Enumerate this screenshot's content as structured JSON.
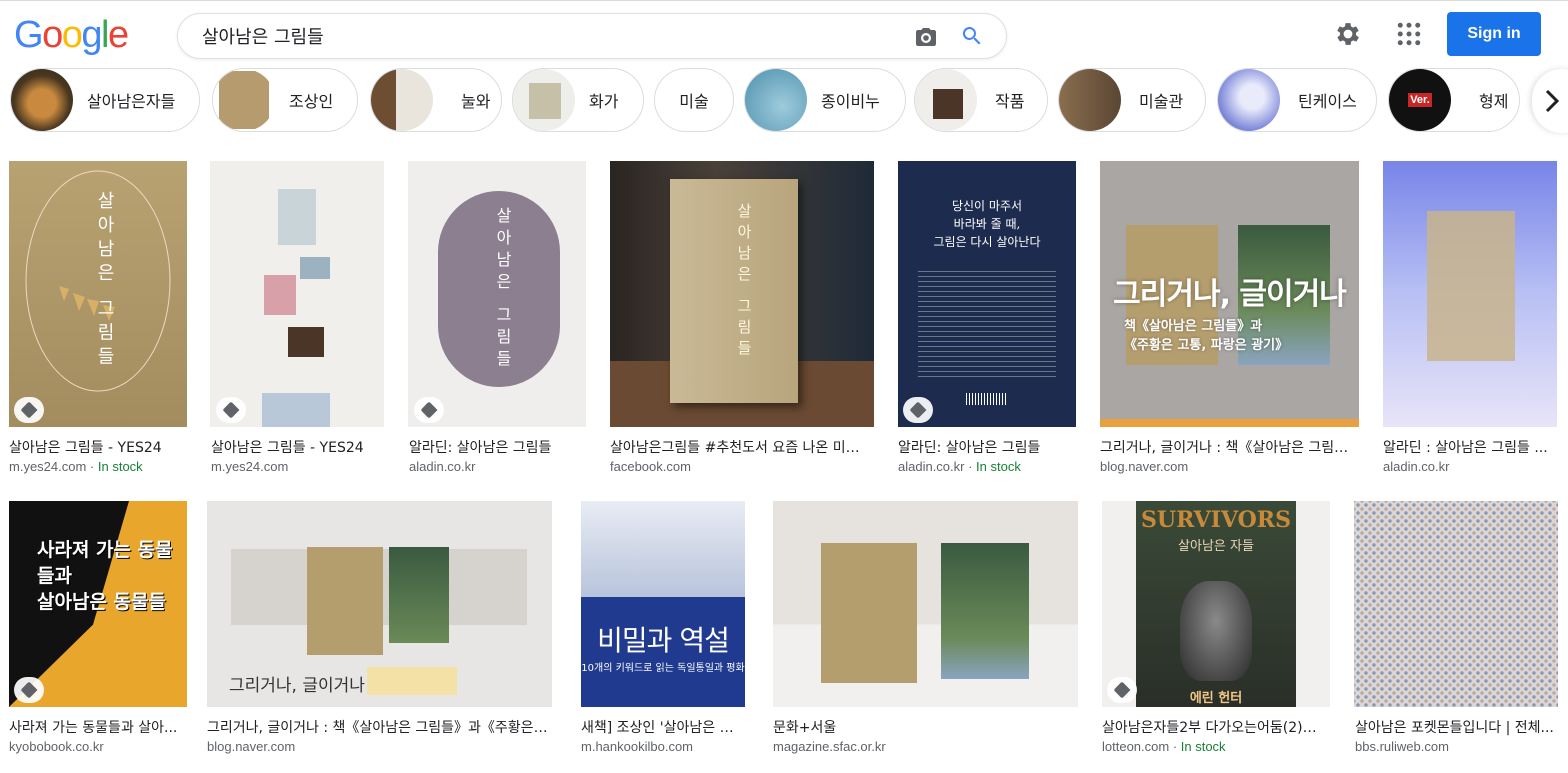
{
  "logo": "Google",
  "search": {
    "query": "살아남은 그림들"
  },
  "header": {
    "sign_in": "Sign in"
  },
  "chips": [
    {
      "label": "살아남은자들",
      "thumb": "#7a5a2e"
    },
    {
      "label": "조상인",
      "thumb": "#b69b6e"
    },
    {
      "label": "눌와",
      "thumb": "#8a6c4f"
    },
    {
      "label": "화가",
      "thumb": "#d8d3c6"
    },
    {
      "label": "미술",
      "thumb": ""
    },
    {
      "label": "종이비누",
      "thumb": "#6aa9c2"
    },
    {
      "label": "작품",
      "thumb": "#e8e6e2"
    },
    {
      "label": "미술관",
      "thumb": "#6b5844"
    },
    {
      "label": "틴케이스",
      "thumb": "#7a85d8"
    },
    {
      "label": "형제",
      "thumb": "#111111"
    }
  ],
  "results_row1": [
    {
      "title": "살아남은 그림들 - YES24",
      "source": "m.yes24.com",
      "stock": "In stock",
      "bg": "#b49e70",
      "tag": true
    },
    {
      "title": "살아남은 그림들 - YES24",
      "source": "m.yes24.com",
      "stock": "",
      "bg": "#eeeceb",
      "tag": true
    },
    {
      "title": "알라딘: 살아남은 그림들",
      "source": "aladin.co.kr",
      "stock": "",
      "bg": "#efedeb",
      "tag": true
    },
    {
      "title": "살아남은그림들 #추천도서 요즘 나온 미술...",
      "source": "facebook.com",
      "stock": "",
      "bg": "#3a3633",
      "tag": false
    },
    {
      "title": "알라딘: 살아남은 그림들",
      "source": "aladin.co.kr",
      "stock": "In stock",
      "bg": "#1c2b4e",
      "tag": true
    },
    {
      "title": "그리거나, 글이거나 : 책《살아남은 그림들...",
      "source": "blog.naver.com",
      "stock": "",
      "bg": "#a9a6a3",
      "tag": false
    },
    {
      "title": "알라딘 : 살아남은 그림들 ...",
      "source": "aladin.co.kr",
      "stock": "",
      "bg": "#8e9cf0",
      "tag": false
    }
  ],
  "results_row2": [
    {
      "title": "사라져 가는 동물들과 살아...",
      "source": "kyobobook.co.kr",
      "stock": "",
      "bg": "#e9a62c",
      "tag": true
    },
    {
      "title": "그리거나, 글이거나 : 책《살아남은 그림들》과《주황은 고...",
      "source": "blog.naver.com",
      "stock": "",
      "bg": "#dcd9d6",
      "tag": false
    },
    {
      "title": "새책] 조상인 '살아남은 그...",
      "source": "m.hankookilbo.com",
      "stock": "",
      "bg": "#1f3a8f",
      "tag": false
    },
    {
      "title": "문화+서울",
      "source": "magazine.sfac.or.kr",
      "stock": "",
      "bg": "#e2dfdb",
      "tag": false
    },
    {
      "title": "살아남은자들2부 다가오는어둠(2)깊...",
      "source": "lotteon.com",
      "stock": "In stock",
      "bg": "#2f3b2c",
      "tag": true
    },
    {
      "title": "살아남은 포켓몬들입니다 | 전체...",
      "source": "bbs.ruliweb.com",
      "stock": "",
      "bg": "#c9c6cf",
      "tag": false
    }
  ],
  "images": {
    "r1_1_title_text": "살아남은 그림들",
    "r1_4_title_text": "살아남은 그림들",
    "r1_5_lines": [
      "당신이 마주서",
      "바라봐 줄 때,",
      "그림은 다시 살아난다"
    ],
    "r1_6_overlay": "그리거나, 글이거나",
    "r1_6_sub": "책《살아남은 그림들》과\n《주황은 고통, 파랑은 광기》",
    "r2_1_overlay": "사라져 가는 동물들과\n살아남은 동물들",
    "r2_2_overlay": "그리거나, 글이거나",
    "r2_3_main": "비밀과 역설",
    "r2_3_sub": "10개의 키워드로 읽는 독일통일과 평화",
    "r2_5_title": "SURVIVORS",
    "r2_5_sub": "살아남은 자들",
    "r2_5_author": "에린 헌터"
  }
}
